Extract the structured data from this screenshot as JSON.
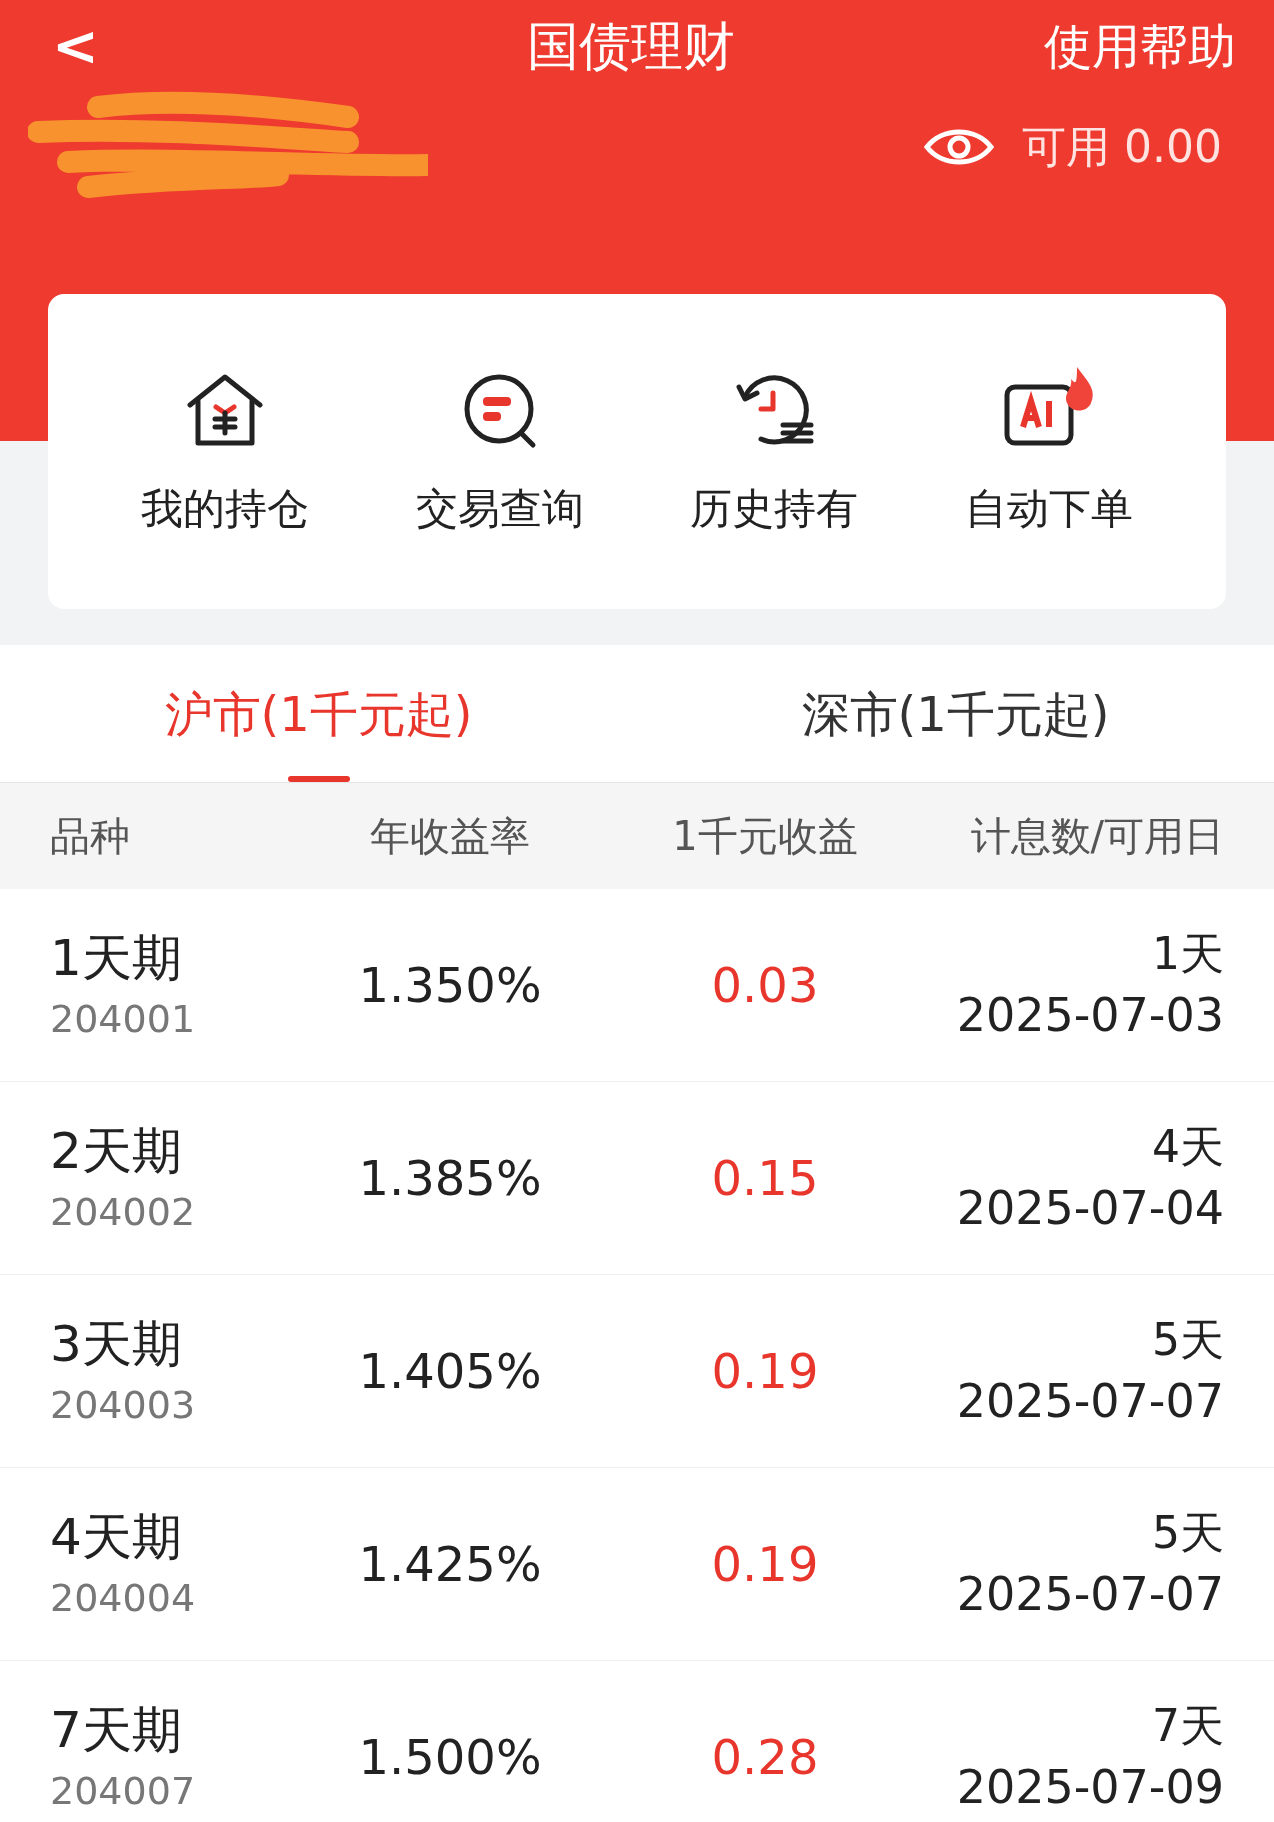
{
  "header": {
    "back": "<",
    "title": "国债理财",
    "help": "使用帮助"
  },
  "account": {
    "available": "可用 0.00"
  },
  "shortcuts": [
    {
      "label": "我的持仓",
      "kind": "holdings"
    },
    {
      "label": "交易查询",
      "kind": "query"
    },
    {
      "label": "历史持有",
      "kind": "history"
    },
    {
      "label": "自动下单",
      "kind": "auto"
    }
  ],
  "tabs": [
    {
      "label": "沪市(1千元起)",
      "selected": true
    },
    {
      "label": "深市(1千元起)",
      "selected": false
    }
  ],
  "table": {
    "columns": [
      "品种",
      "年收益率",
      "1千元收益",
      "计息数/可用日"
    ],
    "rows": [
      {
        "name": "1天期",
        "code": "204001",
        "rate": "1.350%",
        "yield": "0.03",
        "days": "1天",
        "date": "2025-07-03"
      },
      {
        "name": "2天期",
        "code": "204002",
        "rate": "1.385%",
        "yield": "0.15",
        "days": "4天",
        "date": "2025-07-04"
      },
      {
        "name": "3天期",
        "code": "204003",
        "rate": "1.405%",
        "yield": "0.19",
        "days": "5天",
        "date": "2025-07-07"
      },
      {
        "name": "4天期",
        "code": "204004",
        "rate": "1.425%",
        "yield": "0.19",
        "days": "5天",
        "date": "2025-07-07"
      },
      {
        "name": "7天期",
        "code": "204007",
        "rate": "1.500%",
        "yield": "0.28",
        "days": "7天",
        "date": "2025-07-09"
      }
    ]
  }
}
